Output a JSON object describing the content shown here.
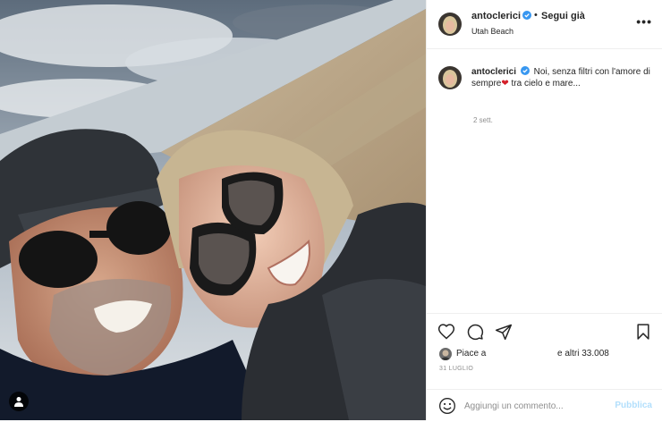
{
  "post": {
    "username": "antoclerici",
    "follow_separator": "•",
    "follow_label": "Segui già",
    "location": "Utah Beach",
    "more_label": "•••"
  },
  "caption": {
    "username": "antoclerici",
    "text_before": "Noi, senza filtri con l'amore di sempre",
    "heart": "❤",
    "text_after": " tra cielo e mare...",
    "time": "2 sett."
  },
  "actions": {
    "likes_label": "Piace a",
    "likes_others": "e altri 33.008",
    "date": "31 LUGLIO"
  },
  "comment": {
    "placeholder": "Aggiungi un commento...",
    "publish_label": "Pubblica"
  },
  "icons": [
    "heart-icon",
    "comment-icon",
    "share-icon",
    "bookmark-icon",
    "emoji-icon",
    "user-tag-icon",
    "verified-badge-icon",
    "more-options-icon"
  ],
  "colors": {
    "verified": "#3897f0",
    "publish": "#b2dffc",
    "heart": "#d4202a"
  }
}
